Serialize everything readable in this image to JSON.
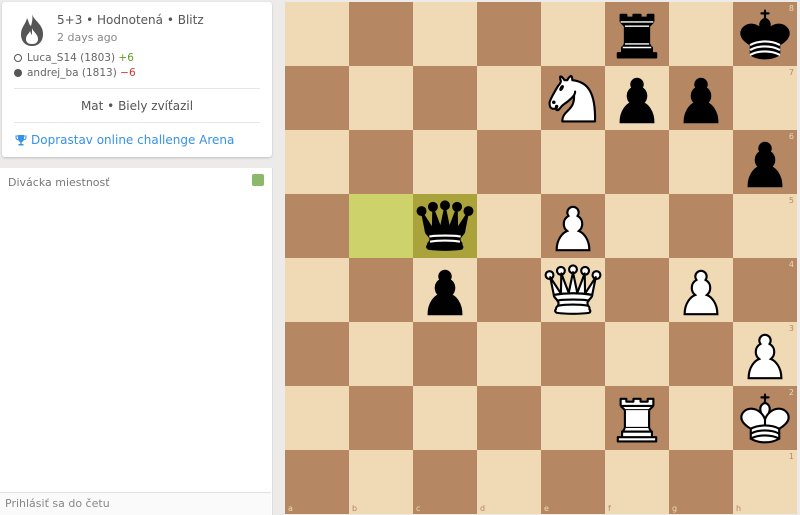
{
  "game": {
    "meta": "5+3 • Hodnotená • Blitz",
    "ago": "2 days ago",
    "players": [
      {
        "name": "Luca_S14 (1803)",
        "diff": "+6",
        "color": "white"
      },
      {
        "name": "andrej_ba (1813)",
        "diff": "−6",
        "color": "black"
      }
    ],
    "result": "Mat • Biely zvíťazil",
    "tournament": "Doprastav online challenge Arena"
  },
  "chat": {
    "title": "Divácka miestnosť",
    "login_prompt": "Prihlásiť sa do četu"
  },
  "board": {
    "files": [
      "a",
      "b",
      "c",
      "d",
      "e",
      "f",
      "g",
      "h"
    ],
    "ranks": [
      "8",
      "7",
      "6",
      "5",
      "4",
      "3",
      "2",
      "1"
    ],
    "pieces": [
      {
        "square": "f8",
        "type": "rook",
        "color": "black"
      },
      {
        "square": "h8",
        "type": "king",
        "color": "black"
      },
      {
        "square": "e7",
        "type": "knight",
        "color": "white"
      },
      {
        "square": "f7",
        "type": "pawn",
        "color": "black"
      },
      {
        "square": "g7",
        "type": "pawn",
        "color": "black"
      },
      {
        "square": "h6",
        "type": "pawn",
        "color": "black"
      },
      {
        "square": "c5",
        "type": "queen",
        "color": "black"
      },
      {
        "square": "e5",
        "type": "pawn",
        "color": "white"
      },
      {
        "square": "c4",
        "type": "pawn",
        "color": "black"
      },
      {
        "square": "e4",
        "type": "queen",
        "color": "white"
      },
      {
        "square": "g4",
        "type": "pawn",
        "color": "white"
      },
      {
        "square": "h3",
        "type": "pawn",
        "color": "white"
      },
      {
        "square": "f2",
        "type": "rook",
        "color": "white"
      },
      {
        "square": "h2",
        "type": "king",
        "color": "white"
      }
    ],
    "last_move": {
      "from": "b5",
      "to": "c5"
    }
  },
  "colors": {
    "light_square": "#f0d9b5",
    "dark_square": "#b58863",
    "highlight_from": "#cdd26a",
    "highlight_to": "#aaa23a",
    "link": "#3692e7",
    "positive": "#629924",
    "negative": "#cc3333"
  }
}
